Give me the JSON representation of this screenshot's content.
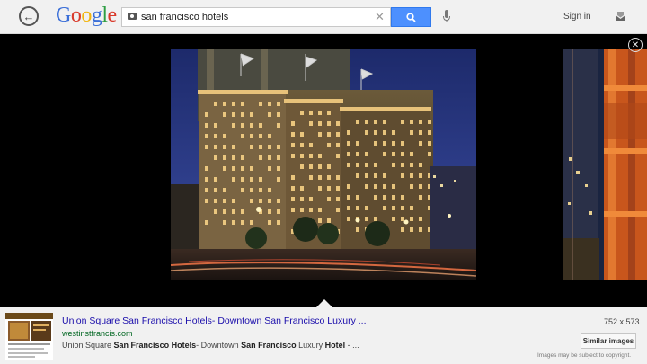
{
  "header": {
    "logo_letters": [
      {
        "ch": "G",
        "color": "#3b6fd8"
      },
      {
        "ch": "o",
        "color": "#d93a2b"
      },
      {
        "ch": "o",
        "color": "#f2b40c"
      },
      {
        "ch": "g",
        "color": "#3b6fd8"
      },
      {
        "ch": "l",
        "color": "#2f9e44"
      },
      {
        "ch": "e",
        "color": "#d93a2b"
      }
    ],
    "search_value": "san francisco hotels",
    "signin_label": "Sign in",
    "back_icon": "←",
    "clear_icon": "✕"
  },
  "viewer": {
    "close_icon": "✕"
  },
  "result": {
    "title": "Union Square San Francisco Hotels- Downtown San Francisco Luxury ...",
    "url": "westinstfrancis.com",
    "snippet_parts": [
      {
        "text": "Union Square ",
        "bold": false
      },
      {
        "text": "San Francisco Hotels",
        "bold": true
      },
      {
        "text": "- Downtown ",
        "bold": false
      },
      {
        "text": "San Francisco",
        "bold": true
      },
      {
        "text": " Luxury ",
        "bold": false
      },
      {
        "text": "Hotel",
        "bold": true
      },
      {
        "text": " - ...",
        "bold": false
      }
    ],
    "dimensions": "752 x 573",
    "similar_label": "Similar images",
    "copyright_note": "Images may be subject to copyright."
  },
  "colors": {
    "accent_blue": "#4d90fe",
    "link_blue": "#1a0dab",
    "url_green": "#006621"
  }
}
